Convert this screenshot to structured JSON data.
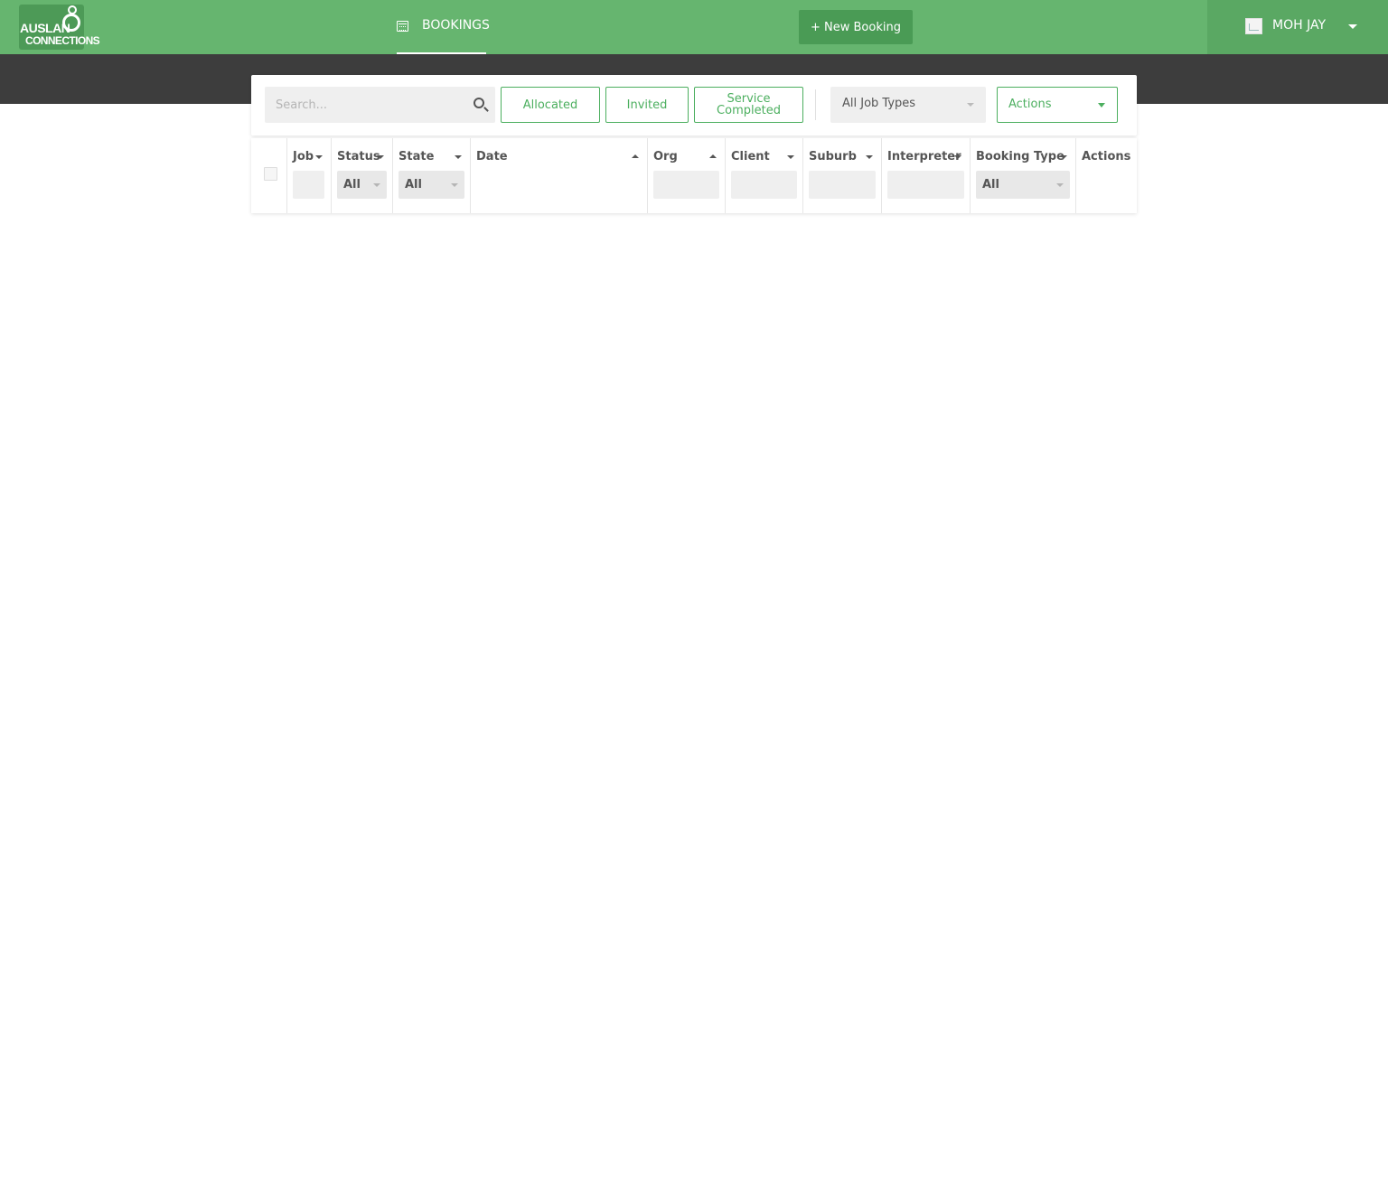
{
  "app": {
    "logo_line1": "AUSLAN",
    "logo_line2": "CONNECTIONS"
  },
  "nav": {
    "bookings_label": "BOOKINGS",
    "new_booking_label": "+ New Booking"
  },
  "user": {
    "name": "MOH JAY"
  },
  "filters": {
    "search_placeholder": "Search...",
    "allocated_label": "Allocated",
    "invited_label": "Invited",
    "service_completed_line1": "Service",
    "service_completed_line2": "Completed",
    "job_types_value": "All Job Types",
    "actions_label": "Actions"
  },
  "table": {
    "columns": {
      "job": "Job",
      "status": "Status",
      "state": "State",
      "date": "Date",
      "org": "Org",
      "client": "Client",
      "suburb": "Suburb",
      "interpreter": "Interpreter",
      "booking_type": "Booking Type",
      "actions": "Actions"
    },
    "filter_values": {
      "status": "All",
      "state": "All",
      "booking_type": "All"
    }
  },
  "colors": {
    "header_green": "#66b56f",
    "accent_green": "#4caf5f",
    "dark_band": "#3d3d3d"
  }
}
